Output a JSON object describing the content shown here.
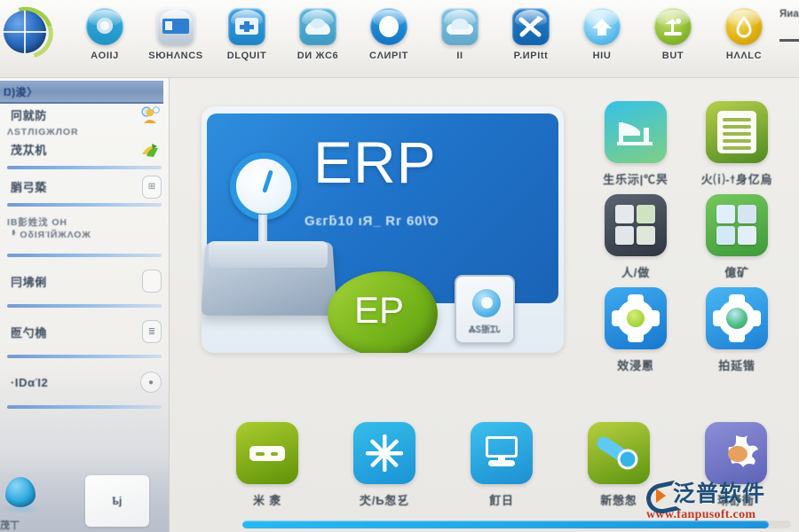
{
  "app": {
    "logo_icon": "globe-logo-icon",
    "user_label": "Яиarm"
  },
  "toolbar": {
    "items": [
      {
        "label": "AOIIЈ",
        "icon": "disc-icon",
        "color": "#39aee0"
      },
      {
        "label": "SЮНΛNCS",
        "icon": "card-reader-icon",
        "color": "#aab7c6"
      },
      {
        "label": "DLQUIT",
        "icon": "screen-plus-icon",
        "color": "#3a9fe0"
      },
      {
        "label": "DИ ЖC6",
        "icon": "cloud-leaf-icon",
        "color": "#5ab6dd"
      },
      {
        "label": "CΛИPIT",
        "icon": "ring-icon",
        "color": "#1f8fd6"
      },
      {
        "label": "II",
        "icon": "cloud-box-icon",
        "color": "#7fc3e6"
      },
      {
        "label": "Ρ.ИРItt",
        "icon": "shuffle-icon",
        "color": "#2b7fc9"
      },
      {
        "label": "НIU",
        "icon": "home-circle-icon",
        "color": "#62c4ef"
      },
      {
        "label": "ΒUΤ",
        "icon": "desk-lamp-icon",
        "color": "#89bb3a"
      },
      {
        "label": "НΛΛLC",
        "icon": "drop-circle-icon",
        "color": "#e2b618"
      }
    ]
  },
  "sidebar": {
    "header": "Ŋ)浚〉",
    "groups": [
      {
        "rows": [
          {
            "label": "冋就防",
            "icon": "user-admin-icon"
          },
          {
            "sub": "ΛЅΤЛΙGЖЛΟR"
          },
          {
            "label": "茂苁机",
            "icon": "refresh-leaf-icon"
          }
        ]
      },
      {
        "rows": [
          {
            "label": "䏴弓蒅",
            "icon": "badge-icon"
          }
        ]
      },
      {
        "rows": [
          {
            "label": "IВ彭姓㳀 ΟΗ",
            "icon": ""
          },
          {
            "sub": "ᆘ ΟδΙЯΊЙЖΛΟЖ"
          }
        ]
      }
    ],
    "items": [
      {
        "label": "冃坲俐",
        "icon": "rounded-pill-icon"
      },
      {
        "label": "匢勺桷",
        "icon": "list-pill-icon"
      },
      {
        "label": "·ΙDαΊ2",
        "icon": "circle-dot-icon"
      }
    ],
    "bottom": {
      "drop_label": "茂丅",
      "card_label": "ҍj"
    }
  },
  "banner": {
    "title": "ERP",
    "subtitle": "Gεгƃ10 ιЯ_ Rг 60\\Ό",
    "badge_text": "EP",
    "mini_card_label": "ᏜᏚ狾ᏆᏓ",
    "gauge_icon": "gauge-icon"
  },
  "apps_right": [
    {
      "label": "生乐沶|℃昗",
      "icon": "factory-icon",
      "c1": "#34c2e6",
      "c2": "#7fcf83"
    },
    {
      "label": "火⒤-ϯ身亿烏",
      "icon": "document-lines-icon",
      "c1": "#b6cf4a",
      "c2": "#4f8a22"
    },
    {
      "label": "人/做",
      "icon": "photo-grid-icon",
      "c1": "#5b6472",
      "c2": "#2f3640"
    },
    {
      "label": "億矿",
      "icon": "app-grid-icon",
      "c1": "#77c85e",
      "c2": "#3d9a3a"
    },
    {
      "label": "效浸慁",
      "icon": "gear-green-hub-icon",
      "c1": "#3eaaf0",
      "c2": "#1877cf"
    },
    {
      "label": "拍延锴",
      "icon": "gear-globe-icon",
      "c1": "#49b6f2",
      "c2": "#1e80d6"
    }
  ],
  "apps_bottom": [
    {
      "label": "米 淾",
      "icon": "server-icon",
      "c1": "#aacc2e",
      "c2": "#5f9208"
    },
    {
      "label": "氼/Ҍ怱乥",
      "icon": "snowflake-icon",
      "c1": "#35bdea",
      "c2": "#1b93d6"
    },
    {
      "label": "飣日",
      "icon": "monitor-icon",
      "c1": "#3cc0ec",
      "c2": "#1d8fd2"
    },
    {
      "label": "新愨怱",
      "icon": "tube-icon",
      "c1": "#b6cf3f",
      "c2": "#5d9410"
    },
    {
      "label": "琳舒衕",
      "icon": "splash-icon",
      "c1": "#8b8fd6",
      "c2": "#5f63b8"
    }
  ],
  "progress": {
    "percent": 96,
    "color": "#23a3e4"
  },
  "watermark": {
    "brand_cn": "泛普软件",
    "url": "www.fanpusoft.com",
    "brand_color": "#1f4e79",
    "url_color": "#c0392b"
  }
}
